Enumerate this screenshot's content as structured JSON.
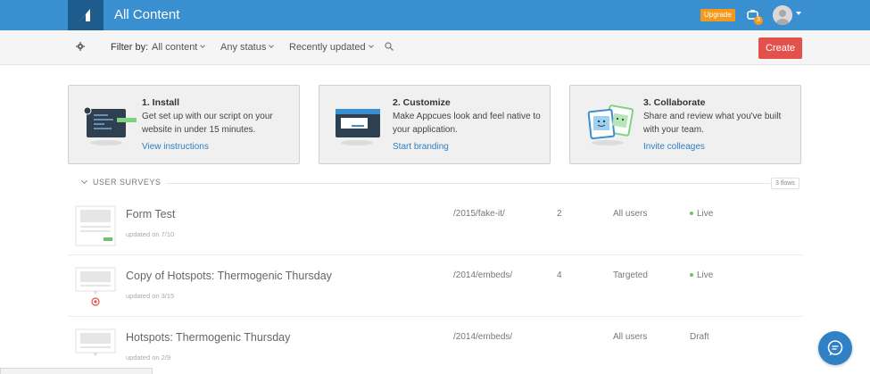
{
  "header": {
    "app_title": "All Content",
    "upgrade_label": "Upgrade",
    "notification_count": "3",
    "brand_color": "#3a8fd0"
  },
  "filterbar": {
    "filter_label": "Filter by:",
    "content_filter": "All content",
    "status_filter": "Any status",
    "sort_filter": "Recently updated",
    "create_label": "Create"
  },
  "cards": [
    {
      "title": "1. Install",
      "description": "Get set up with our script on your website in under 15 minutes.",
      "link": "View instructions",
      "icon": "code-window-icon"
    },
    {
      "title": "2. Customize",
      "description": "Make Appcues look and feel native to your application.",
      "link": "Start branding",
      "icon": "browser-window-icon"
    },
    {
      "title": "3. Collaborate",
      "description": "Share and review what you've built with your team.",
      "link": "Invite colleages",
      "icon": "smiley-cards-icon"
    }
  ],
  "section": {
    "title": "USER SURVEYS",
    "flow_count": "3 flows"
  },
  "flows": [
    {
      "title": "Form Test",
      "updated": "updated on 7/10",
      "url": "/2015/fake-it/",
      "steps": "2",
      "audience": "All users",
      "status": "Live"
    },
    {
      "title": "Copy of Hotspots: Thermogenic Thursday",
      "updated": "updated on 3/15",
      "url": "/2014/embeds/",
      "steps": "4",
      "audience": "Targeted",
      "status": "Live"
    },
    {
      "title": "Hotspots: Thermogenic Thursday",
      "updated": "updated on 2/9",
      "url": "/2014/embeds/",
      "steps": "",
      "audience": "All users",
      "status": "Draft"
    }
  ]
}
